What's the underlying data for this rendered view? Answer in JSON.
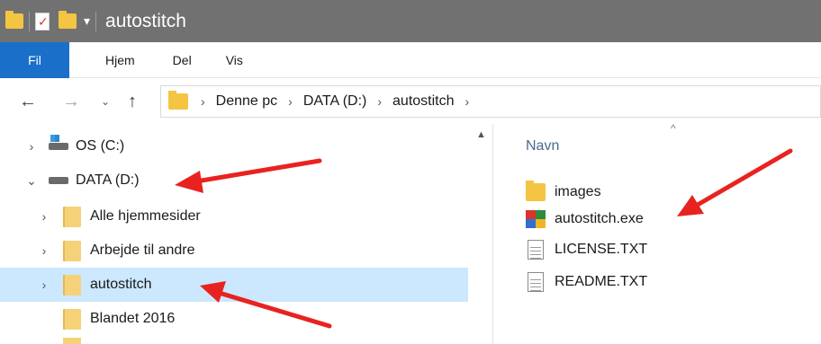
{
  "window": {
    "title": "autostitch"
  },
  "quick_access": {
    "icons": [
      "folder-icon",
      "properties-icon",
      "new-folder-icon",
      "dropdown-icon"
    ]
  },
  "ribbon": {
    "tabs": [
      {
        "label": "Fil"
      },
      {
        "label": "Hjem"
      },
      {
        "label": "Del"
      },
      {
        "label": "Vis"
      }
    ]
  },
  "address": {
    "back_glyph": "←",
    "forward_glyph": "→",
    "recent_glyph": "⌄",
    "up_glyph": "↑",
    "crumbs": [
      "Denne pc",
      "DATA (D:)",
      "autostitch"
    ],
    "separator": "›"
  },
  "nav_tree": {
    "items": [
      {
        "label": "OS (C:)",
        "icon": "os-drive-icon",
        "chevron": "›"
      },
      {
        "label": "DATA (D:)",
        "icon": "drive-icon",
        "chevron": "⌄"
      },
      {
        "label": "Alle hjemmesider",
        "icon": "folder-icon",
        "chevron": "›"
      },
      {
        "label": "Arbejde til andre",
        "icon": "folder-icon",
        "chevron": "›"
      },
      {
        "label": "autostitch",
        "icon": "folder-icon",
        "chevron": "›",
        "selected": true
      },
      {
        "label": "Blandet 2016",
        "icon": "folder-icon",
        "chevron": ""
      }
    ]
  },
  "content": {
    "column_header": "Navn",
    "files": [
      {
        "name": "images",
        "icon": "folder-icon"
      },
      {
        "name": "autostitch.exe",
        "icon": "exe-icon"
      },
      {
        "name": "LICENSE.TXT",
        "icon": "text-file-icon"
      },
      {
        "name": "README.TXT",
        "icon": "text-file-icon"
      }
    ]
  },
  "colors": {
    "titlebar": "#717171",
    "file_tab": "#1a6fc9",
    "selection": "#cce8ff",
    "annotation_arrow": "#e8231f"
  }
}
